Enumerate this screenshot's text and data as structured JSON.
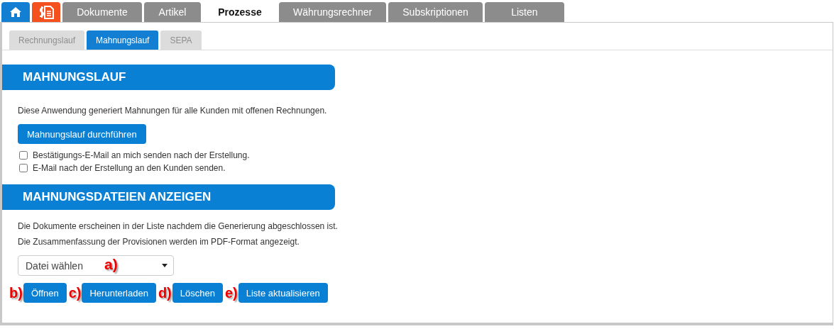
{
  "main_tabs": [
    {
      "kind": "home",
      "selected": false
    },
    {
      "kind": "invoice",
      "selected": false
    },
    {
      "kind": "text",
      "label": "Dokumente",
      "selected": false
    },
    {
      "kind": "text",
      "label": "Artikel",
      "selected": false
    },
    {
      "kind": "text",
      "label": "Prozesse",
      "selected": true
    },
    {
      "kind": "text",
      "label": "Währungsrechner",
      "selected": false
    },
    {
      "kind": "text",
      "label": "Subskriptionen",
      "selected": false
    },
    {
      "kind": "text",
      "label": "Listen",
      "selected": false
    }
  ],
  "sub_tabs": [
    {
      "label": "Rechnungslauf",
      "selected": false
    },
    {
      "label": "Mahnungslauf",
      "selected": true
    },
    {
      "label": "SEPA",
      "selected": false
    }
  ],
  "run_section": {
    "title": "MAHNUNGSLAUF",
    "description": "Diese Anwendung generiert Mahnungen für alle Kunden mit offenen Rechnungen.",
    "button": "Mahnungslauf durchführen",
    "options": [
      {
        "label": "Bestätigungs-E-Mail an mich senden nach der Erstellung.",
        "checked": false
      },
      {
        "label": "E-Mail nach der Erstellung an den Kunden senden.",
        "checked": false
      }
    ]
  },
  "files_section": {
    "title": "MAHNUNGSDATEIEN ANZEIGEN",
    "description": [
      "Die Dokumente erscheinen in der Liste nachdem die Generierung abgeschlossen ist.",
      "Die Zusammenfassung der Provisionen werden im PDF-Format angezeigt."
    ],
    "select": {
      "value": "Datei wählen",
      "marker": "a)"
    },
    "buttons": [
      {
        "label": "Öffnen",
        "marker": "b)"
      },
      {
        "label": "Herunterladen",
        "marker": "c)"
      },
      {
        "label": "Löschen",
        "marker": "d)"
      },
      {
        "label": "Liste aktualisieren",
        "marker": "e)"
      }
    ]
  }
}
